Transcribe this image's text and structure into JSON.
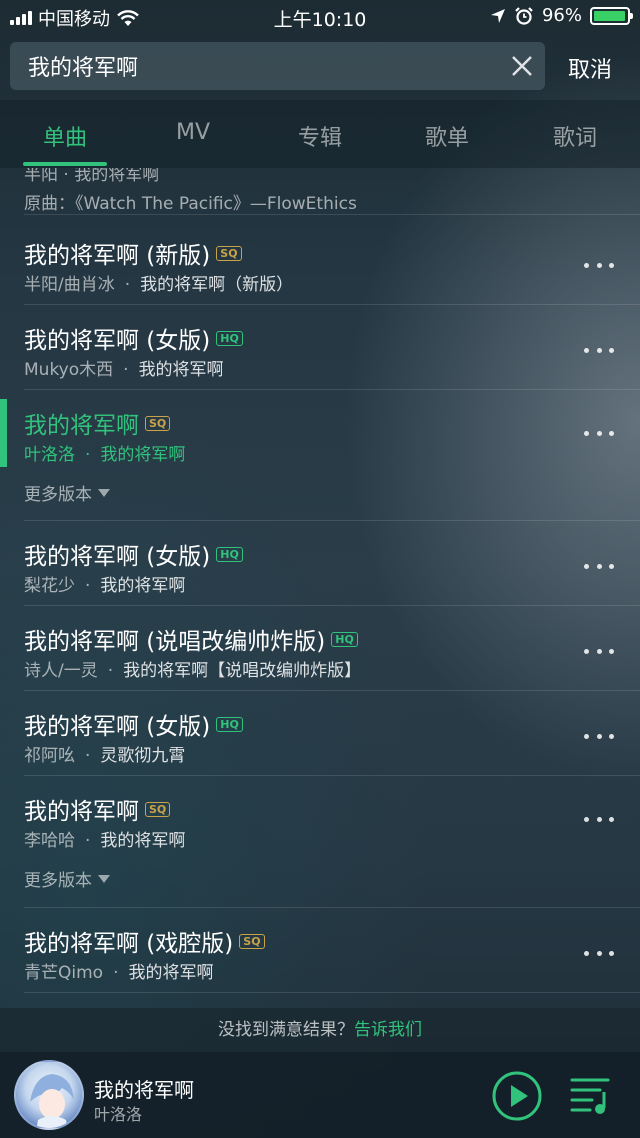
{
  "status_bar": {
    "carrier": "中国移动",
    "time": "上午10:10",
    "battery": "96%",
    "battery_level": 0.96
  },
  "search": {
    "query": "我的将军啊",
    "cancel_label": "取消"
  },
  "tabs": [
    "单曲",
    "MV",
    "专辑",
    "歌单",
    "歌词"
  ],
  "active_tab": 0,
  "partial_row": {
    "sub": "半阳 · 我的将军啊",
    "original": "原曲：《Watch The Pacific》—FlowEthics"
  },
  "songs": [
    {
      "title": "我的将军啊 (新版)",
      "quality": "SQ",
      "artist": "半阳/曲肖冰",
      "album": "我的将军啊（新版）"
    },
    {
      "title": "我的将军啊 (女版)",
      "quality": "HQ",
      "artist": "Mukyo木西",
      "album": "我的将军啊"
    },
    {
      "title": "我的将军啊",
      "quality": "SQ",
      "artist": "叶洛洛",
      "album": "我的将军啊",
      "playing": true,
      "more_versions": "更多版本"
    },
    {
      "title": "我的将军啊 (女版)",
      "quality": "HQ",
      "artist": "梨花少",
      "album": "我的将军啊"
    },
    {
      "title": "我的将军啊 (说唱改编帅炸版)",
      "quality": "HQ",
      "artist": "诗人/一灵",
      "album": "我的将军啊【说唱改编帅炸版】"
    },
    {
      "title": "我的将军啊 (女版)",
      "quality": "HQ",
      "artist": "祁阿吆",
      "album": "灵歌彻九霄"
    },
    {
      "title": "我的将军啊",
      "quality": "SQ",
      "artist": "李哈哈",
      "album": "我的将军啊",
      "more_versions": "更多版本"
    },
    {
      "title": "我的将军啊 (戏腔版)",
      "quality": "SQ",
      "artist": "青芒Qimo",
      "album": "我的将军啊"
    }
  ],
  "hint": {
    "text": "没找到满意结果？",
    "link": "告诉我们"
  },
  "player": {
    "title": "我的将军啊",
    "artist": "叶洛洛"
  },
  "colors": {
    "accent": "#31c27c",
    "sq_badge": "#c9a24a",
    "hq_badge": "#31c27c"
  }
}
